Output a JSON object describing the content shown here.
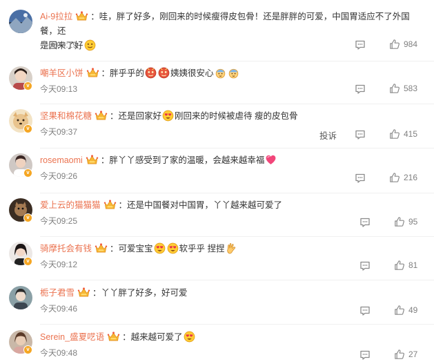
{
  "comments": [
    {
      "user": "Ai-9拉拉",
      "text": "：哇，胖了好多，刚回来的时候瘦得皮包骨！还是胖胖的可爱，中国胃适应不了外国餐，还",
      "text2": "是回来了好",
      "time": "今天09:19",
      "likes": "984",
      "verified": false
    },
    {
      "user": "嘲羊区小饼",
      "text": "：胖乎乎的",
      "text_b": "姨姨很安心",
      "time": "今天09:13",
      "likes": "583",
      "verified": true
    },
    {
      "user": "坚果和棉花糖",
      "text": "：还是回家好",
      "text_b": "刚回来的时候被虐待 瘦的皮包骨",
      "time": "今天09:37",
      "likes": "415",
      "verified": true,
      "report": "投诉"
    },
    {
      "user": "rosemaomi",
      "text": "：胖丫丫感受到了家的温暖，会越来越幸福",
      "time": "今天09:26",
      "likes": "216",
      "verified": true
    },
    {
      "user": "爱上云的猫猫猫",
      "text": "：还是中国餐对中国胃，丫丫越来越可爱了",
      "time": "今天09:25",
      "likes": "95",
      "verified": true
    },
    {
      "user": "骑摩托会有钱",
      "text": "：可爱宝宝",
      "text_b": "软乎乎 捏捏",
      "time": "今天09:12",
      "likes": "81",
      "verified": true
    },
    {
      "user": "栀子君雪",
      "text": "：丫丫胖了好多，好可爱",
      "time": "今天09:46",
      "likes": "49",
      "verified": false
    },
    {
      "user": "Serein_盛夏呓语",
      "text": "：越来越可爱了",
      "time": "今天09:48",
      "likes": "27",
      "verified": true
    }
  ],
  "colors": {
    "username": "#eb7350",
    "meta": "#808080",
    "badge": "#f5a623"
  },
  "icons": [
    "crown-icon",
    "comment-icon",
    "like-icon",
    "verified-badge-icon"
  ]
}
